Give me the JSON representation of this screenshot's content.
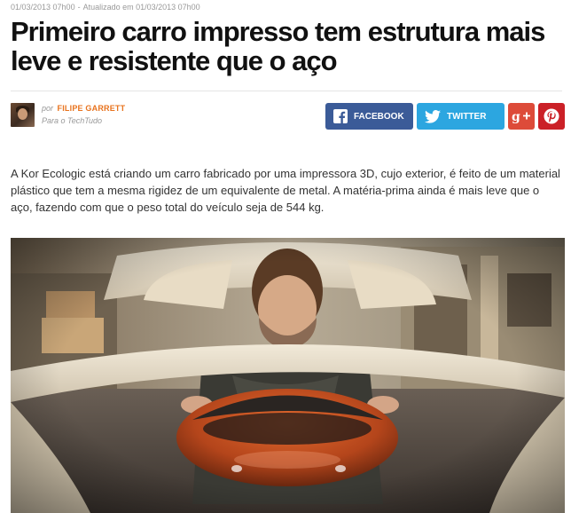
{
  "meta": {
    "published": "01/03/2013 07h00",
    "separator": "-",
    "updated": "Atualizado em 01/03/2013 07h00"
  },
  "article": {
    "title": "Primeiro carro impresso tem estrutura mais leve e resistente que o aço",
    "author_prefix": "por",
    "author": "FILIPE GARRETT",
    "author_outlet": "Para o TechTudo",
    "body": "A Kor Ecologic está criando um carro fabricado por uma impressora 3D, cujo exterior, é feito de um material plástico que tem a mesma rigidez de um equivalente de metal. A matéria-prima ainda é mais leve que o aço, fazendo com que o peso total do veículo seja de 544 kg."
  },
  "share": {
    "facebook_label": "FACEBOOK",
    "twitter_label": "TWITTER",
    "facebook_color": "#3b5b98",
    "twitter_color": "#2ca6e0",
    "googleplus_color": "#dd4b39",
    "pinterest_color": "#cb2027",
    "icons": [
      "facebook-icon",
      "twitter-icon",
      "google-plus-icon",
      "pinterest-icon"
    ]
  },
  "image": {
    "subject": "man-with-3d-printed-car-body-icon"
  }
}
